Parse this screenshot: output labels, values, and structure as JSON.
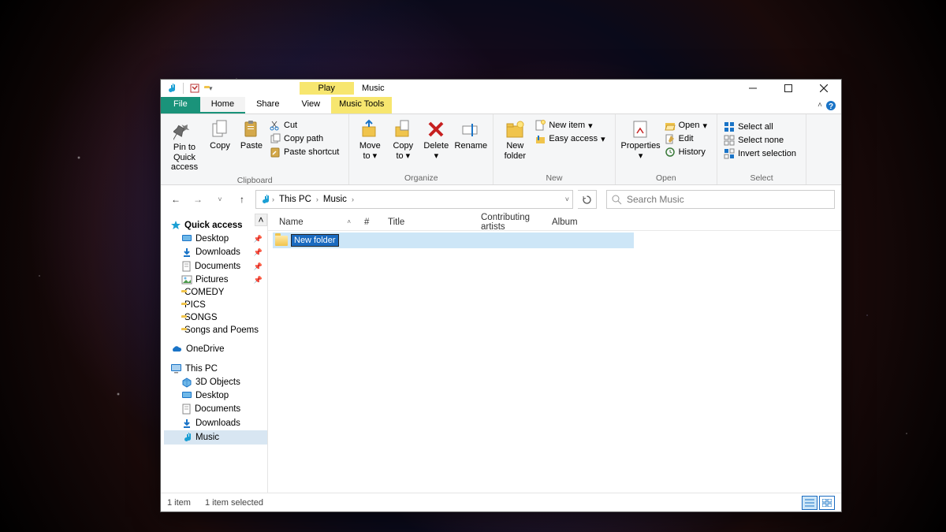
{
  "titlebar": {
    "context_tab": "Play",
    "title": "Music"
  },
  "ribbon": {
    "file": "File",
    "tabs": [
      "Home",
      "Share",
      "View"
    ],
    "active_tab": "Home",
    "context_tools": "Music Tools",
    "groups": {
      "clipboard": {
        "label": "Clipboard",
        "pin": "Pin to Quick access",
        "copy": "Copy",
        "paste": "Paste",
        "cut": "Cut",
        "copy_path": "Copy path",
        "paste_shortcut": "Paste shortcut"
      },
      "organize": {
        "label": "Organize",
        "move_to": "Move to",
        "copy_to": "Copy to",
        "delete": "Delete",
        "rename": "Rename"
      },
      "new": {
        "label": "New",
        "new_folder": "New folder",
        "new_item": "New item",
        "easy_access": "Easy access"
      },
      "open": {
        "label": "Open",
        "properties": "Properties",
        "open": "Open",
        "edit": "Edit",
        "history": "History"
      },
      "select": {
        "label": "Select",
        "select_all": "Select all",
        "select_none": "Select none",
        "invert": "Invert selection"
      }
    }
  },
  "address": {
    "crumbs": [
      "This PC",
      "Music"
    ]
  },
  "search": {
    "placeholder": "Search Music"
  },
  "columns": [
    "Name",
    "#",
    "Title",
    "Contributing artists",
    "Album"
  ],
  "sidebar": {
    "quick_access": "Quick access",
    "qa_items": [
      "Desktop",
      "Downloads",
      "Documents",
      "Pictures",
      "COMEDY",
      "PICS",
      "SONGS",
      "Songs and Poems"
    ],
    "qa_pinned": [
      true,
      true,
      true,
      true,
      false,
      false,
      false,
      false
    ],
    "onedrive": "OneDrive",
    "this_pc": "This PC",
    "pc_items": [
      "3D Objects",
      "Desktop",
      "Documents",
      "Downloads",
      "Music"
    ],
    "pc_selected": "Music"
  },
  "files": [
    {
      "name": "New folder",
      "editing": true
    }
  ],
  "status": {
    "count": "1 item",
    "selected": "1 item selected"
  }
}
